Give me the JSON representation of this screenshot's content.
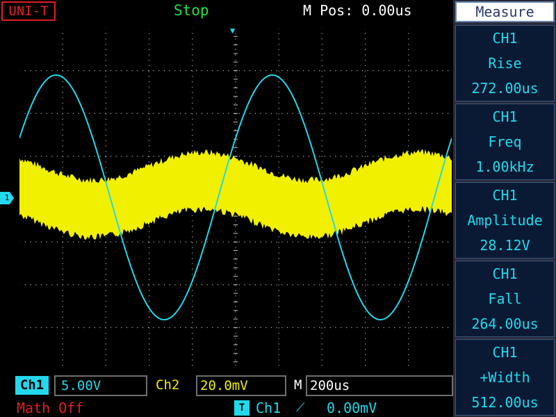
{
  "header": {
    "brand": "UNI-T",
    "status": "Stop",
    "m_pos": "M Pos: 0.00us"
  },
  "measure_panel": {
    "title": "Measure",
    "items": [
      {
        "channel": "CH1",
        "label": "Rise",
        "value": "272.00us"
      },
      {
        "channel": "CH1",
        "label": "Freq",
        "value": "1.00kHz"
      },
      {
        "channel": "CH1",
        "label": "Amplitude",
        "value": "28.12V"
      },
      {
        "channel": "CH1",
        "label": "Fall",
        "value": "264.00us"
      },
      {
        "channel": "CH1",
        "label": "+Width",
        "value": "512.00us"
      }
    ]
  },
  "bottom": {
    "ch1_label": "Ch1",
    "ch1_scale": "5.00V",
    "ch2_label": "Ch2",
    "ch2_scale": "20.0mV",
    "m_label": "M",
    "timebase": "200us",
    "math": "Math Off",
    "trigger_badge": "T",
    "trigger_source": "Ch1",
    "trigger_edge": "⟋",
    "trigger_level": "0.00mV"
  },
  "markers": {
    "ch1_ground": "1",
    "trigger_pos": "▼"
  },
  "colors": {
    "ch1": "#22d8ec",
    "ch2": "#f0f000",
    "grid": "#c8c8c8",
    "brand": "#e02020",
    "status": "#22e04a"
  }
}
